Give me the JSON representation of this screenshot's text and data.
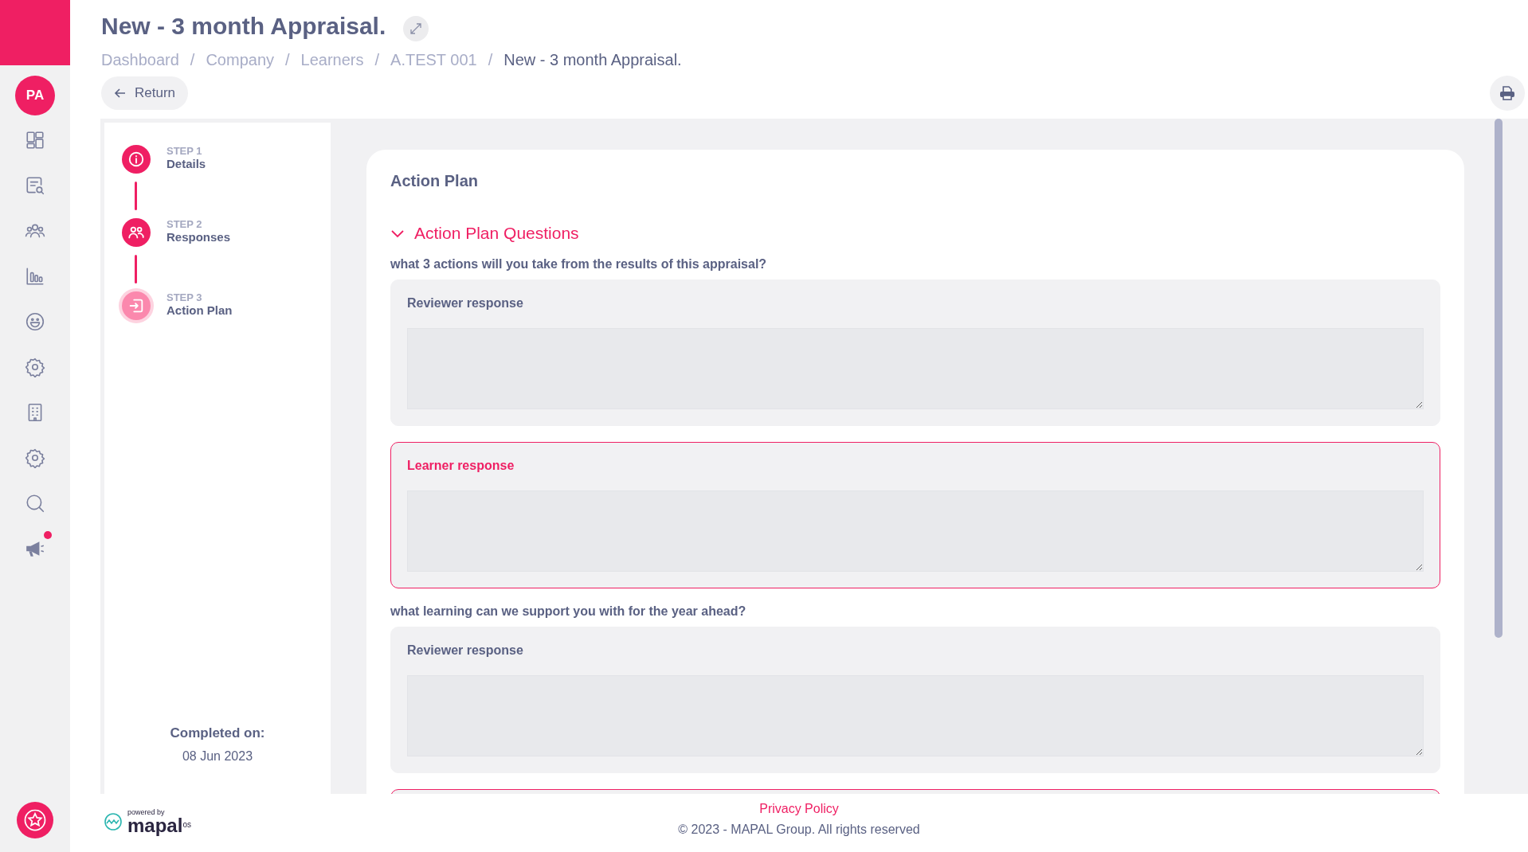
{
  "sidebar": {
    "avatar": "PA",
    "nav": [
      {
        "kind": "dashboard",
        "notification": false
      },
      {
        "kind": "review",
        "notification": false
      },
      {
        "kind": "people",
        "notification": false
      },
      {
        "kind": "chart",
        "notification": false
      },
      {
        "kind": "smiley",
        "notification": false
      },
      {
        "kind": "gear",
        "notification": false
      },
      {
        "kind": "building",
        "notification": false
      },
      {
        "kind": "gear",
        "notification": false
      },
      {
        "kind": "search",
        "notification": false
      },
      {
        "kind": "megaphone",
        "notification": true
      }
    ]
  },
  "header": {
    "title": "New - 3 month Appraisal.",
    "breadcrumb": [
      {
        "kind": "link",
        "text": "Dashboard"
      },
      {
        "kind": "separator",
        "text": "/"
      },
      {
        "kind": "link",
        "text": "Company"
      },
      {
        "kind": "separator",
        "text": "/"
      },
      {
        "kind": "link",
        "text": "Learners"
      },
      {
        "kind": "separator",
        "text": "/"
      },
      {
        "kind": "link",
        "text": "A.TEST 001"
      },
      {
        "kind": "separator",
        "text": "/"
      },
      {
        "kind": "current",
        "text": "New - 3 month Appraisal."
      }
    ],
    "return_button": "Return"
  },
  "steps": [
    {
      "kind": "info",
      "step": "STEP 1",
      "label": "Details",
      "selected": false
    },
    {
      "kind": "people",
      "step": "STEP 2",
      "label": "Responses",
      "selected": false
    },
    {
      "kind": "enter",
      "step": "STEP 3",
      "label": "Action Plan",
      "selected": true
    }
  ],
  "completed": {
    "label": "Completed on:",
    "date": "08 Jun 2023"
  },
  "form": {
    "title": "Action Plan",
    "section": {
      "title": "Action Plan Questions",
      "expanded": true
    },
    "questions": [
      {
        "text": "what 3 actions will you take from the results of this appraisal?",
        "responses": [
          {
            "kind": "reviewer",
            "label": "Reviewer response"
          },
          {
            "kind": "learner",
            "label": "Learner response"
          }
        ]
      },
      {
        "text": "what learning can we support you with for the year ahead?",
        "responses": [
          {
            "kind": "reviewer",
            "label": "Reviewer response"
          },
          {
            "kind": "learner"
          }
        ]
      }
    ]
  },
  "footer": {
    "powered_by": "powered by",
    "brand": "mapal",
    "brand_suffix": "os",
    "link": "Privacy Policy",
    "copyright": "© 2023 - MAPAL Group. All rights reserved"
  }
}
